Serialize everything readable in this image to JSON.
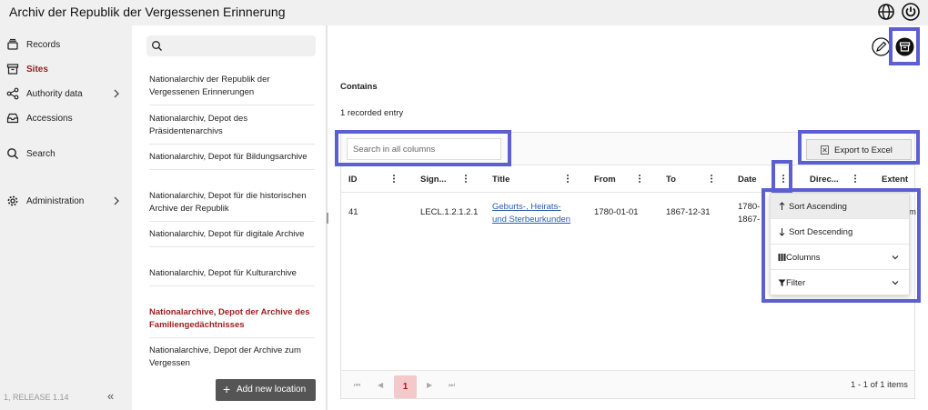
{
  "app": {
    "title": "Archiv der Republik der Vergessenen Erinnerung"
  },
  "nav": {
    "items": [
      {
        "label": "Records",
        "icon": "stack-icon"
      },
      {
        "label": "Sites",
        "icon": "archive-box-icon"
      },
      {
        "label": "Authority data",
        "icon": "share-nodes-icon"
      },
      {
        "label": "Accessions",
        "icon": "inbox-icon"
      },
      {
        "label": "Search",
        "icon": "search-icon"
      },
      {
        "label": "Administration",
        "icon": "gear-icon"
      }
    ],
    "active": "Sites",
    "release": "1, RELEASE 1.14"
  },
  "locations": {
    "items": [
      "Nationalarchiv der Republik der Vergessenen Erinnerungen",
      "Nationalarchiv, Depot des Präsidentenarchivs",
      "Nationalarchiv, Depot für Bildungsarchive",
      "Nationalarchiv, Depot für die historischen Archive der Republik",
      "Nationalarchiv, Depot für digitale Archive",
      "Nationalarchiv, Depot für Kulturarchive",
      "Nationalarchive, Depot der Archive des Familiengedächtnisses",
      "Nationalarchive, Depot der Archive zum Vergessen"
    ],
    "active_index": 6,
    "add_label": "Add new location"
  },
  "main": {
    "contains_title": "Contains",
    "count_text": "1 recorded entry",
    "search_placeholder": "Search in all columns",
    "export_label": "Export to Excel",
    "columns": [
      "ID",
      "Sign...",
      "Title",
      "From",
      "To",
      "Date",
      "Direc...",
      "Extent"
    ],
    "rows": [
      {
        "id": "41",
        "signature": "LECL.1.2.1.2.1",
        "title_line1": "Geburts-, Heirats-",
        "title_line2": "und Sterbeurkunden",
        "from": "1780-01-01",
        "to": "1867-12-31",
        "date_line1": "1780-",
        "date_line2": "1867-",
        "extent": "m"
      }
    ],
    "pagination": {
      "current": "1",
      "info": "1 - 1 of 1 items"
    }
  },
  "column_menu": {
    "items": [
      "Sort Ascending",
      "Sort Descending",
      "Columns",
      "Filter"
    ]
  },
  "colors": {
    "accent": "#9b1c1c",
    "highlight": "#5b5fcf",
    "link": "#2a5db0"
  }
}
